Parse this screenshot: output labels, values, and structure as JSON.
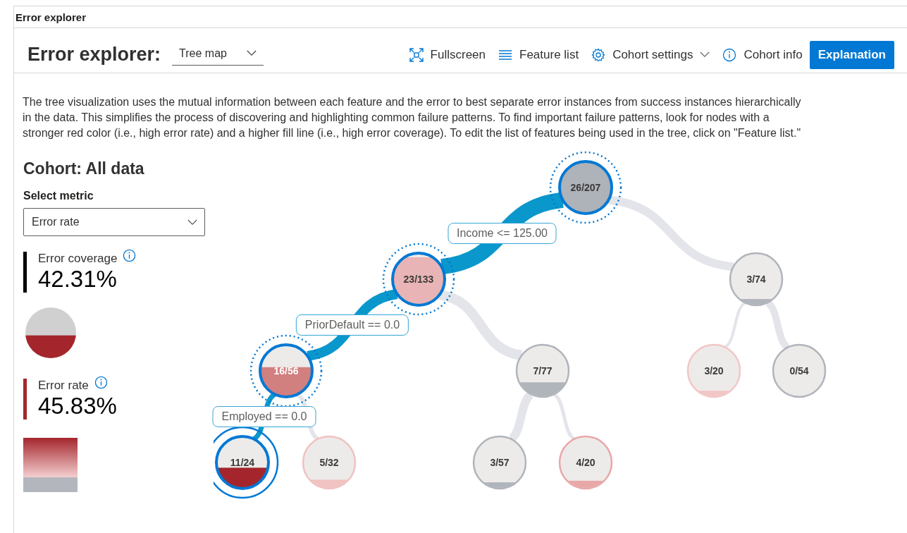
{
  "panel_title": "Error explorer",
  "toolbar": {
    "title": "Error explorer:",
    "view_select": {
      "value": "Tree map"
    },
    "actions": [
      {
        "kind": "fullscreen",
        "label": "Fullscreen",
        "dropdown": false
      },
      {
        "kind": "list",
        "label": "Feature list",
        "dropdown": false
      },
      {
        "kind": "settings",
        "label": "Cohort settings",
        "dropdown": true
      },
      {
        "kind": "info",
        "label": "Cohort info",
        "dropdown": false
      }
    ],
    "primary_button": "Explanation"
  },
  "description": "The tree visualization uses the mutual information between each feature and the error to best separate error instances from success instances hierarchically in the data. This simplifies the process of discovering and highlighting common failure patterns. To find important failure patterns, look for nodes with a stronger red color (i.e., high error rate) and a higher fill line (i.e., high error coverage). To edit the list of features being used in the tree, click on \"Feature list.\"",
  "cohort": {
    "title": "Cohort: All data",
    "metric_label": "Select metric",
    "metric_select": {
      "value": "Error rate"
    },
    "coverage": {
      "label": "Error coverage",
      "value": "42.31%"
    },
    "rate": {
      "label": "Error rate",
      "value": "45.83%"
    }
  },
  "tree": {
    "label": "26/207",
    "color": "#aeb2b9",
    "on_path": true,
    "selected": false,
    "light_text": false,
    "children": [
      {
        "label": "23/133",
        "color": "#e8b4b6",
        "on_path": true,
        "selected": false,
        "light_text": false,
        "condition": "Income <= 125.00",
        "children": [
          {
            "label": "16/56",
            "color": "#d27f80",
            "on_path": true,
            "selected": false,
            "light_text": true,
            "condition": "PriorDefault == 0.0",
            "children": [
              {
                "label": "11/24",
                "color": "#a4262c",
                "on_path": true,
                "selected": true,
                "light_text": false,
                "condition": "Employed == 0.0"
              },
              {
                "label": "5/32",
                "color": "#f0c2c2",
                "on_path": false,
                "selected": false,
                "light_text": false
              }
            ]
          },
          {
            "label": "7/77",
            "color": "#b0b4bb",
            "on_path": false,
            "selected": false,
            "light_text": false,
            "children": [
              {
                "label": "3/57",
                "color": "#b0b4bb",
                "on_path": false,
                "selected": false,
                "light_text": false
              },
              {
                "label": "4/20",
                "color": "#e9a8a8",
                "on_path": false,
                "selected": false,
                "light_text": false
              }
            ]
          }
        ]
      },
      {
        "label": "3/74",
        "color": "#b0b4bb",
        "on_path": false,
        "selected": false,
        "light_text": false,
        "children": [
          {
            "label": "3/20",
            "color": "#f2c6c6",
            "on_path": false,
            "selected": false,
            "light_text": false
          },
          {
            "label": "0/54",
            "color": "#b0b4bb",
            "on_path": false,
            "selected": false,
            "light_text": false
          }
        ]
      }
    ]
  }
}
